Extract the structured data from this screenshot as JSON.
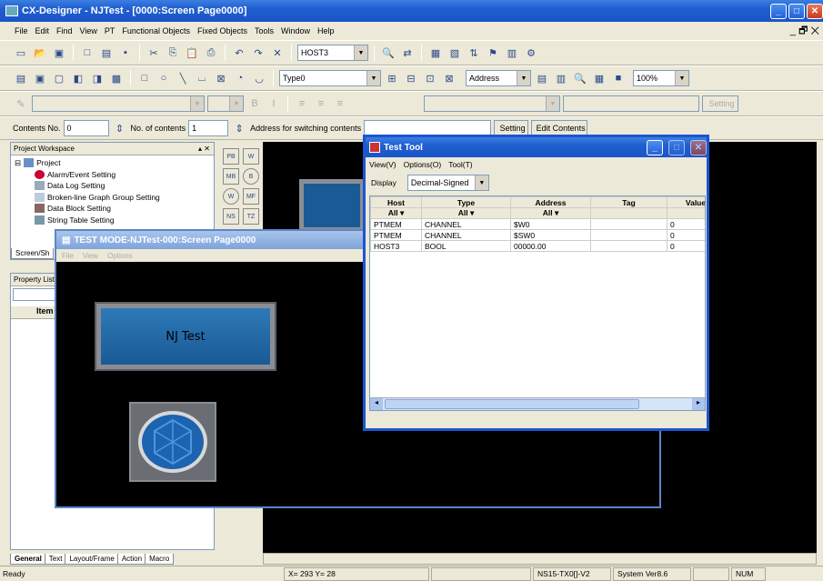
{
  "app": {
    "title": "CX-Designer - NJTest - [0000:Screen Page0000]",
    "min": "_",
    "max": "□",
    "close": "✕",
    "mdi_controls": "_ 🗗 ✕"
  },
  "menu": [
    "File",
    "Edit",
    "Find",
    "View",
    "PT",
    "Functional Objects",
    "Fixed Objects",
    "Tools",
    "Window",
    "Help"
  ],
  "toolbar1": {
    "host_combo": "HOST3"
  },
  "toolbar2": {
    "type_combo": "Type0",
    "address_combo": "Address",
    "zoom_combo": "100%"
  },
  "toolbar3": {
    "setting_button": "Setting"
  },
  "toolbar4": {
    "contents_no_label": "Contents No.",
    "contents_no_value": "0",
    "no_of_contents_label": "No. of contents",
    "no_of_contents_value": "1",
    "address_switch_label": "Address for switching contents",
    "setting_button": "Setting",
    "edit_contents_button": "Edit Contents"
  },
  "workspace": {
    "title": "Project Workspace",
    "items": [
      "Project",
      "Alarm/Event Setting",
      "Data Log Setting",
      "Broken-line Graph Group Setting",
      "Data Block Setting",
      "String Table Setting"
    ],
    "tab": "Screen/Sh"
  },
  "property": {
    "title": "Property List",
    "item_header": "Item"
  },
  "object_palette": [
    "PB",
    "W",
    "MB",
    "B",
    "W",
    "MF",
    "NS",
    "TZ"
  ],
  "testmode": {
    "title": "TEST MODE-NJTest-000:Screen Page0000",
    "menu": [
      "File",
      "View",
      "Options"
    ],
    "button_label": "NJ Test"
  },
  "testtool": {
    "title": "Test Tool",
    "menu": [
      "View(V)",
      "Options(O)",
      "Tool(T)"
    ],
    "display_label": "Display",
    "display_value": "Decimal-Signed",
    "columns": [
      "Host",
      "Type",
      "Address",
      "Tag",
      "Value"
    ],
    "filter": [
      "All",
      "All",
      "All"
    ],
    "rows": [
      [
        "PTMEM",
        "CHANNEL",
        "$W0",
        "",
        "0"
      ],
      [
        "PTMEM",
        "CHANNEL",
        "$SW0",
        "",
        "0"
      ],
      [
        "HOST3",
        "BOOL",
        "00000.00",
        "",
        "0"
      ]
    ]
  },
  "bottom_tabs": [
    "General",
    "Text",
    "Layout/Frame",
    "Action",
    "Macro"
  ],
  "status": {
    "ready": "Ready",
    "coords": "X= 293 Y= 28",
    "model": "NS15-TX0[]-V2",
    "system": "System Ver8.6",
    "num": "NUM"
  }
}
